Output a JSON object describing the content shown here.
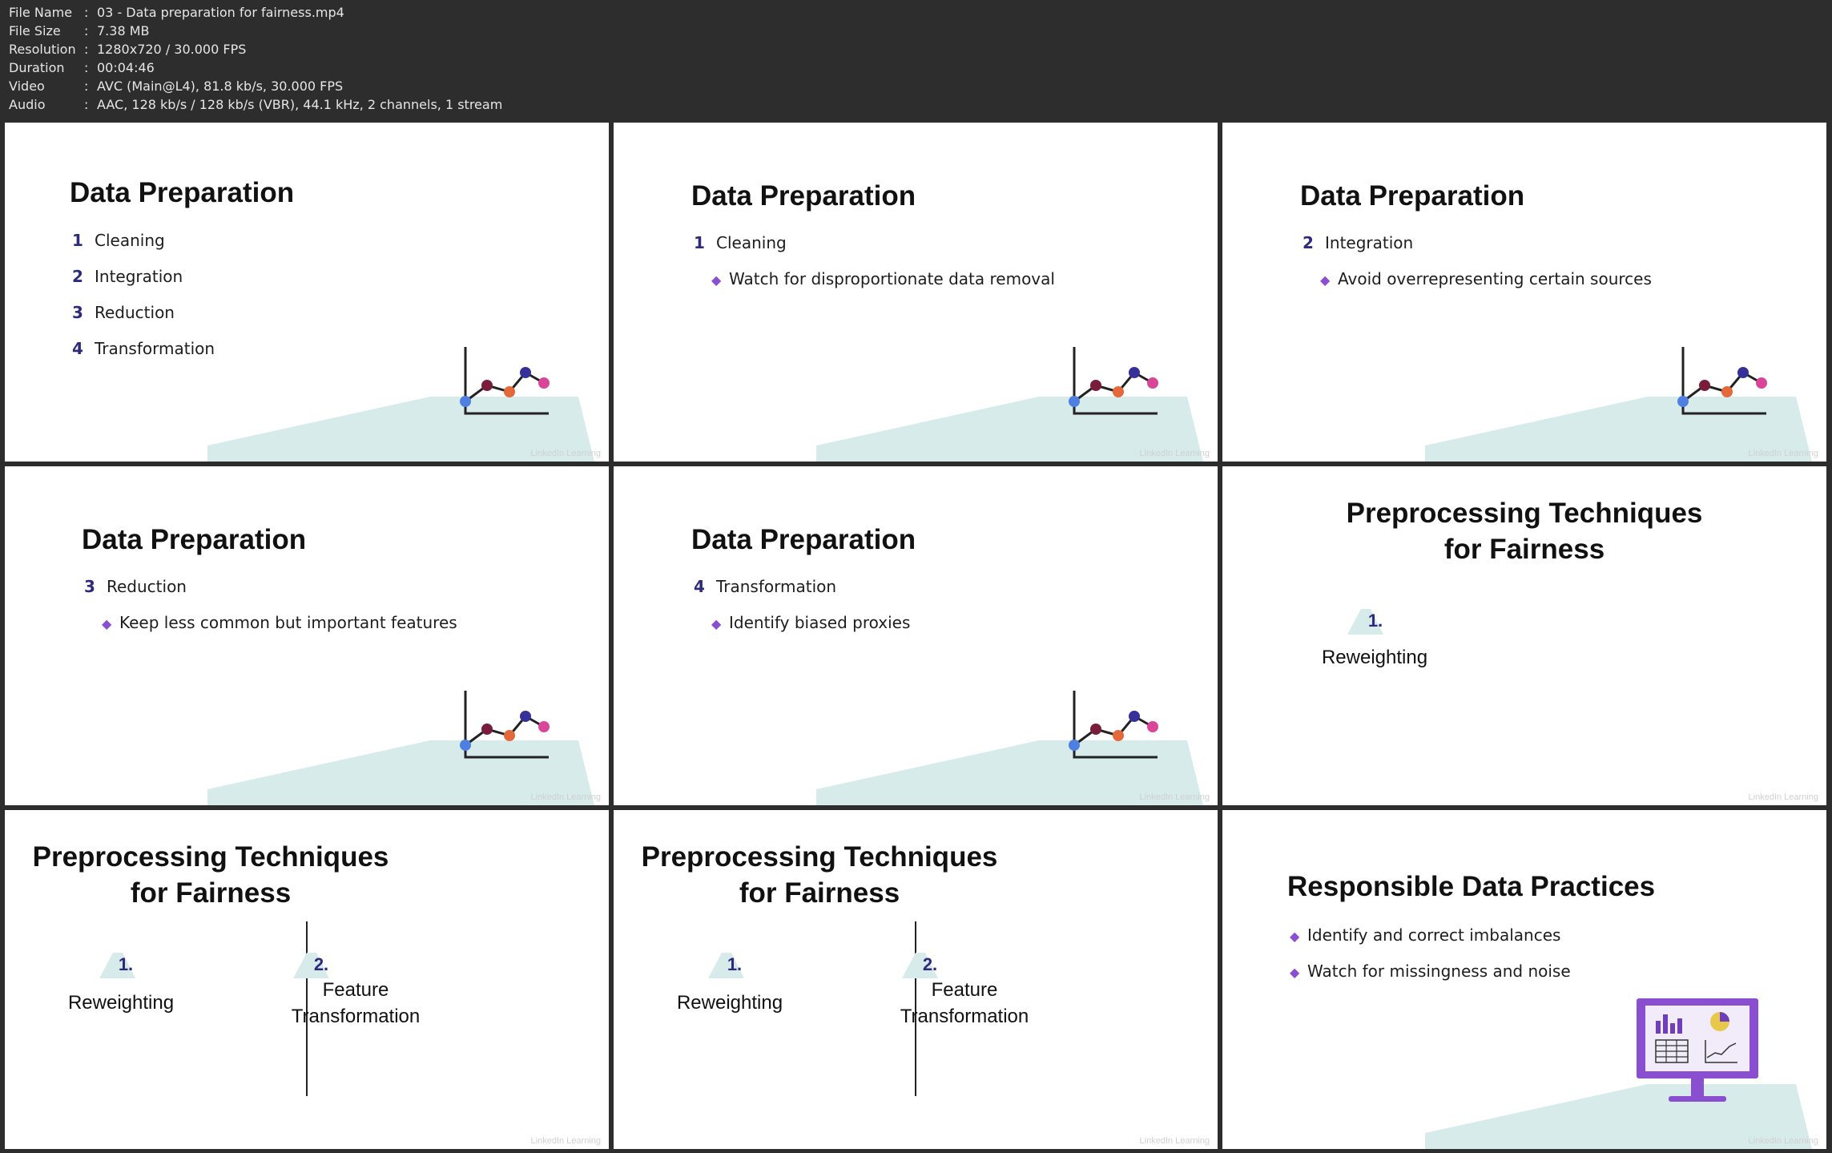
{
  "info": {
    "rows": [
      {
        "key": "File Name",
        "value": "03 - Data preparation for fairness.mp4"
      },
      {
        "key": "File Size",
        "value": "7.38 MB"
      },
      {
        "key": "Resolution",
        "value": "1280x720 / 30.000 FPS"
      },
      {
        "key": "Duration",
        "value": "00:04:46"
      },
      {
        "key": "Video",
        "value": "AVC (Main@L4), 81.8 kb/s, 30.000 FPS"
      },
      {
        "key": "Audio",
        "value": "AAC, 128 kb/s / 128 kb/s (VBR), 44.1 kHz, 2 channels, 1 stream"
      }
    ]
  },
  "watermark": "LinkedIn Learning",
  "panels": {
    "p1": {
      "title": "Data Preparation",
      "items": [
        {
          "num": "1",
          "label": "Cleaning"
        },
        {
          "num": "2",
          "label": "Integration"
        },
        {
          "num": "3",
          "label": "Reduction"
        },
        {
          "num": "4",
          "label": "Transformation"
        }
      ]
    },
    "p2": {
      "title": "Data Preparation",
      "num": "1",
      "label": "Cleaning",
      "bullet": "Watch for disproportionate data removal"
    },
    "p3": {
      "title": "Data Preparation",
      "num": "2",
      "label": "Integration",
      "bullet": "Avoid overrepresenting certain sources"
    },
    "p4": {
      "title": "Data Preparation",
      "num": "3",
      "label": "Reduction",
      "bullet": "Keep less common but important features"
    },
    "p5": {
      "title": "Data Preparation",
      "num": "4",
      "label": "Transformation",
      "bullet": "Identify biased proxies"
    },
    "p6": {
      "title_line1": "Preprocessing Techniques",
      "title_line2": "for Fairness",
      "t1_num": "1.",
      "t1_label": "Reweighting"
    },
    "p7": {
      "title_line1": "Preprocessing Techniques",
      "title_line2": "for Fairness",
      "t1_num": "1.",
      "t1_label": "Reweighting",
      "t2_num": "2.",
      "t2_line1": "Feature",
      "t2_line2": "Transformation"
    },
    "p8": {
      "title_line1": "Preprocessing Techniques",
      "title_line2": "for Fairness",
      "t1_num": "1.",
      "t1_label": "Reweighting",
      "t2_num": "2.",
      "t2_line1": "Feature",
      "t2_line2": "Transformation"
    },
    "p9": {
      "title": "Responsible Data Practices",
      "bullets": [
        "Identify and correct imbalances",
        "Watch for missingness and noise"
      ]
    }
  },
  "colors": {
    "accent_purple": "#8a4fd0",
    "number_navy": "#2e2a7c",
    "floor_teal": "#d6ebea",
    "dot_blue": "#4f7fe0",
    "dot_maroon": "#7a1d3a",
    "dot_orange": "#e4683a",
    "dot_navy": "#36309a",
    "dot_pink": "#d94599"
  }
}
